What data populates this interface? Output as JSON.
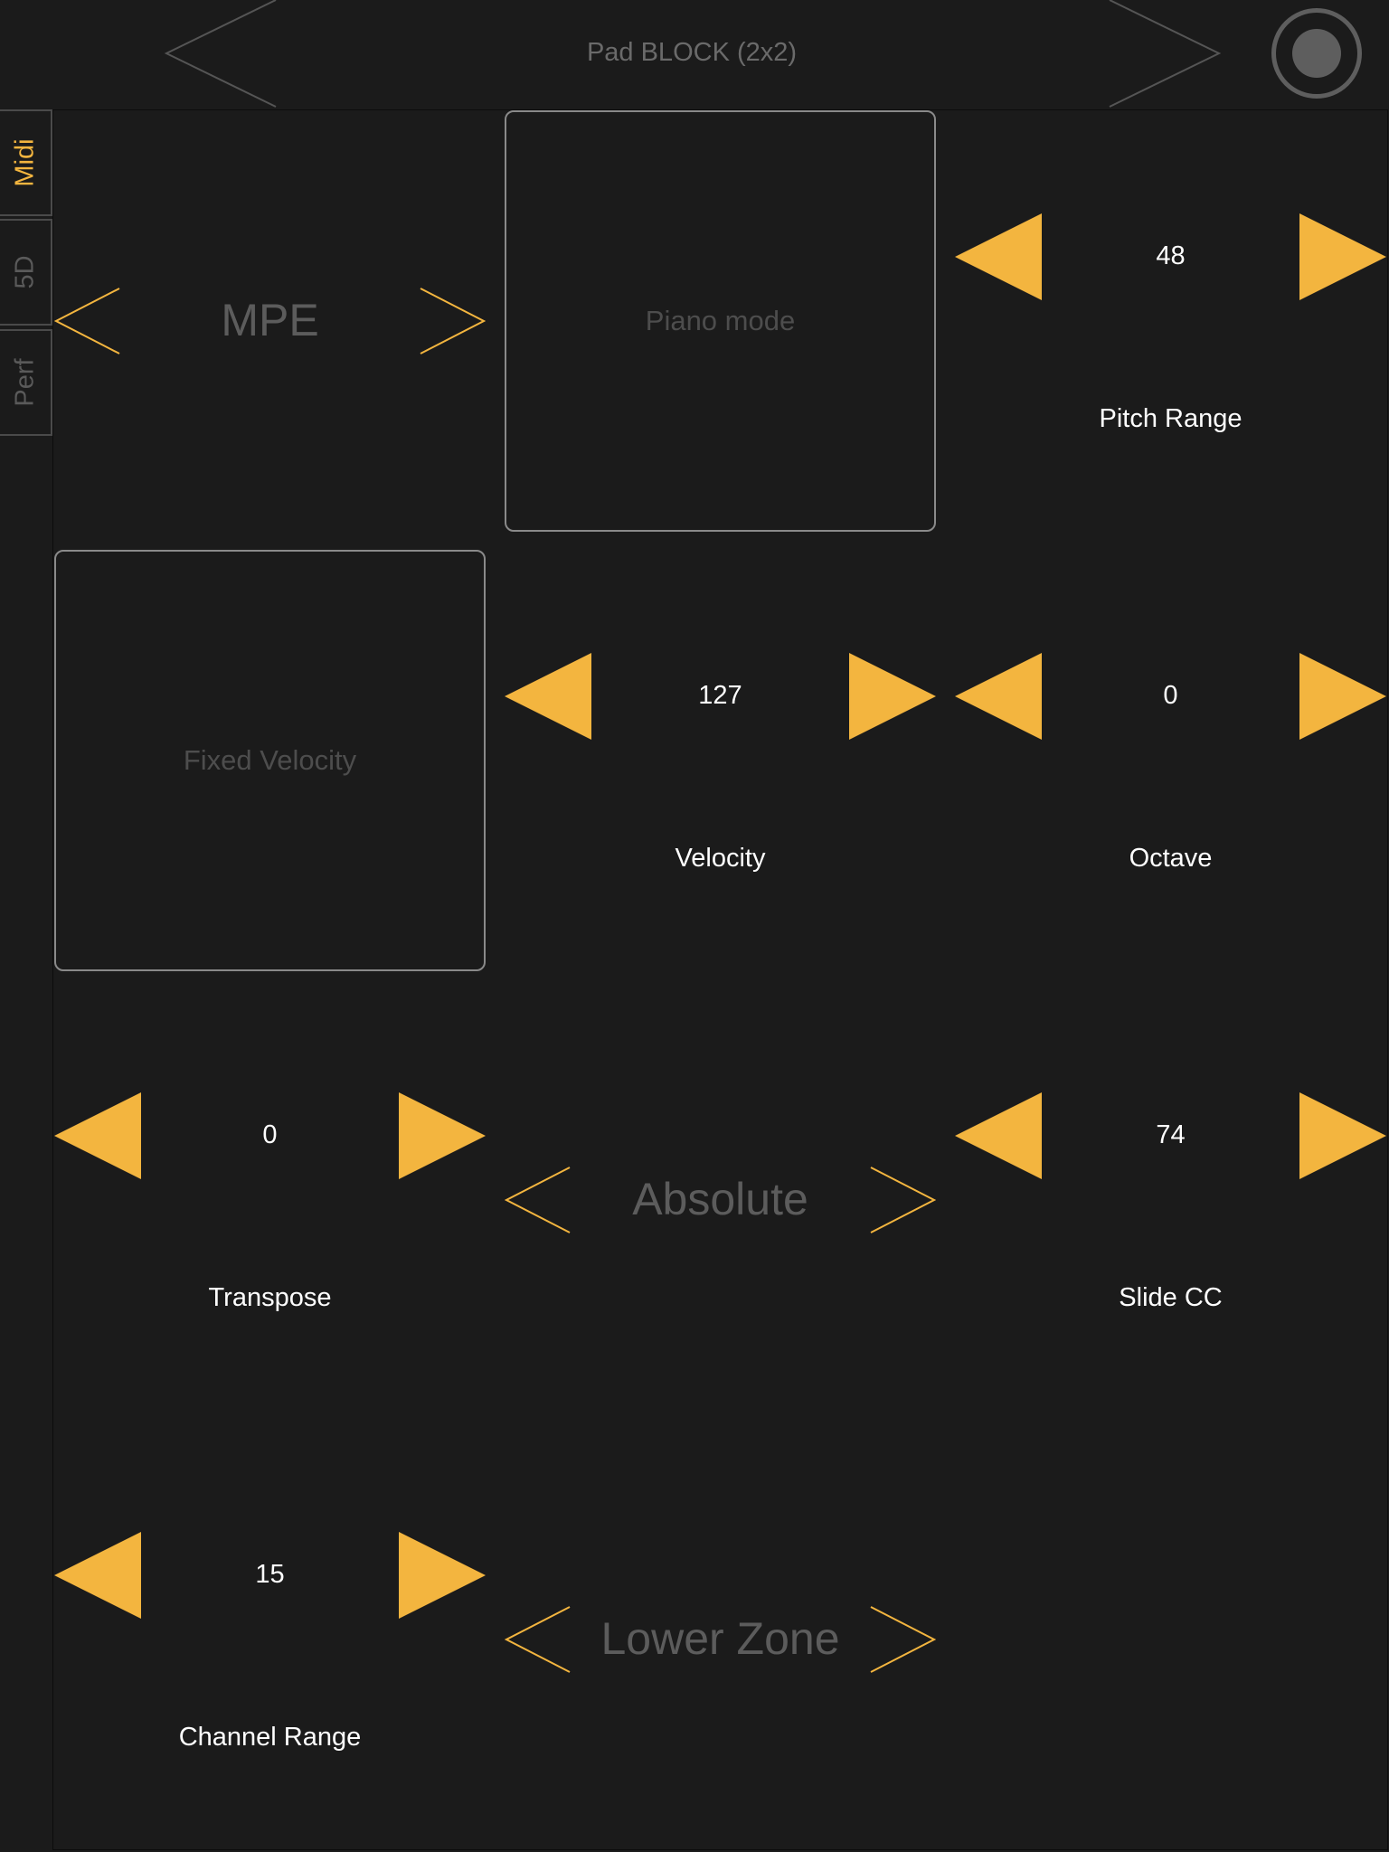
{
  "header": {
    "device_title": "Pad BLOCK (2x2)"
  },
  "side_tabs": [
    {
      "label": "Midi",
      "active": true
    },
    {
      "label": "5D",
      "active": false
    },
    {
      "label": "Perf",
      "active": false
    }
  ],
  "controls": {
    "mode_chooser": {
      "value": "MPE"
    },
    "piano_mode": {
      "label": "Piano mode"
    },
    "pitch_range": {
      "value": "48",
      "label": "Pitch Range"
    },
    "fixed_velocity": {
      "label": "Fixed Velocity"
    },
    "velocity": {
      "value": "127",
      "label": "Velocity"
    },
    "octave": {
      "value": "0",
      "label": "Octave"
    },
    "transpose": {
      "value": "0",
      "label": "Transpose"
    },
    "slide_mode_chooser": {
      "value": "Absolute"
    },
    "slide_cc": {
      "value": "74",
      "label": "Slide CC"
    },
    "channel_range": {
      "value": "15",
      "label": "Channel Range"
    },
    "zone_chooser": {
      "value": "Lower Zone"
    }
  },
  "colors": {
    "background": "#1b1b1b",
    "accent": "#f3b53f",
    "text": "#ffffff",
    "muted_text": "#5c5c5c",
    "toggle_border": "#8a8a8a"
  }
}
